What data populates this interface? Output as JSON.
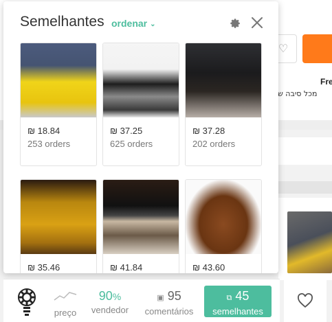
{
  "background": {
    "free_label": "Fre",
    "hebrew_text": "מכל סיבה ש"
  },
  "panel": {
    "title": "Semelhantes",
    "sort_label": "ordenar",
    "products": [
      {
        "price": "₪ 18.84",
        "orders": "253 orders"
      },
      {
        "price": "₪ 37.25",
        "orders": "625 orders"
      },
      {
        "price": "₪ 37.28",
        "orders": "202 orders"
      },
      {
        "price": "₪ 35.46",
        "orders": ""
      },
      {
        "price": "₪ 41.84",
        "orders": ""
      },
      {
        "price": "₪ 43.60",
        "orders": ""
      }
    ]
  },
  "bar": {
    "preco_label": "preço",
    "vendedor_value": "90",
    "vendedor_unit": "%",
    "vendedor_label": "vendedor",
    "comments_value": "95",
    "comments_label": "comentários",
    "similar_value": "45",
    "similar_label": "semelhantes"
  },
  "colors": {
    "accent": "#4dbd9e",
    "buy_button": "#ff7a1a"
  }
}
